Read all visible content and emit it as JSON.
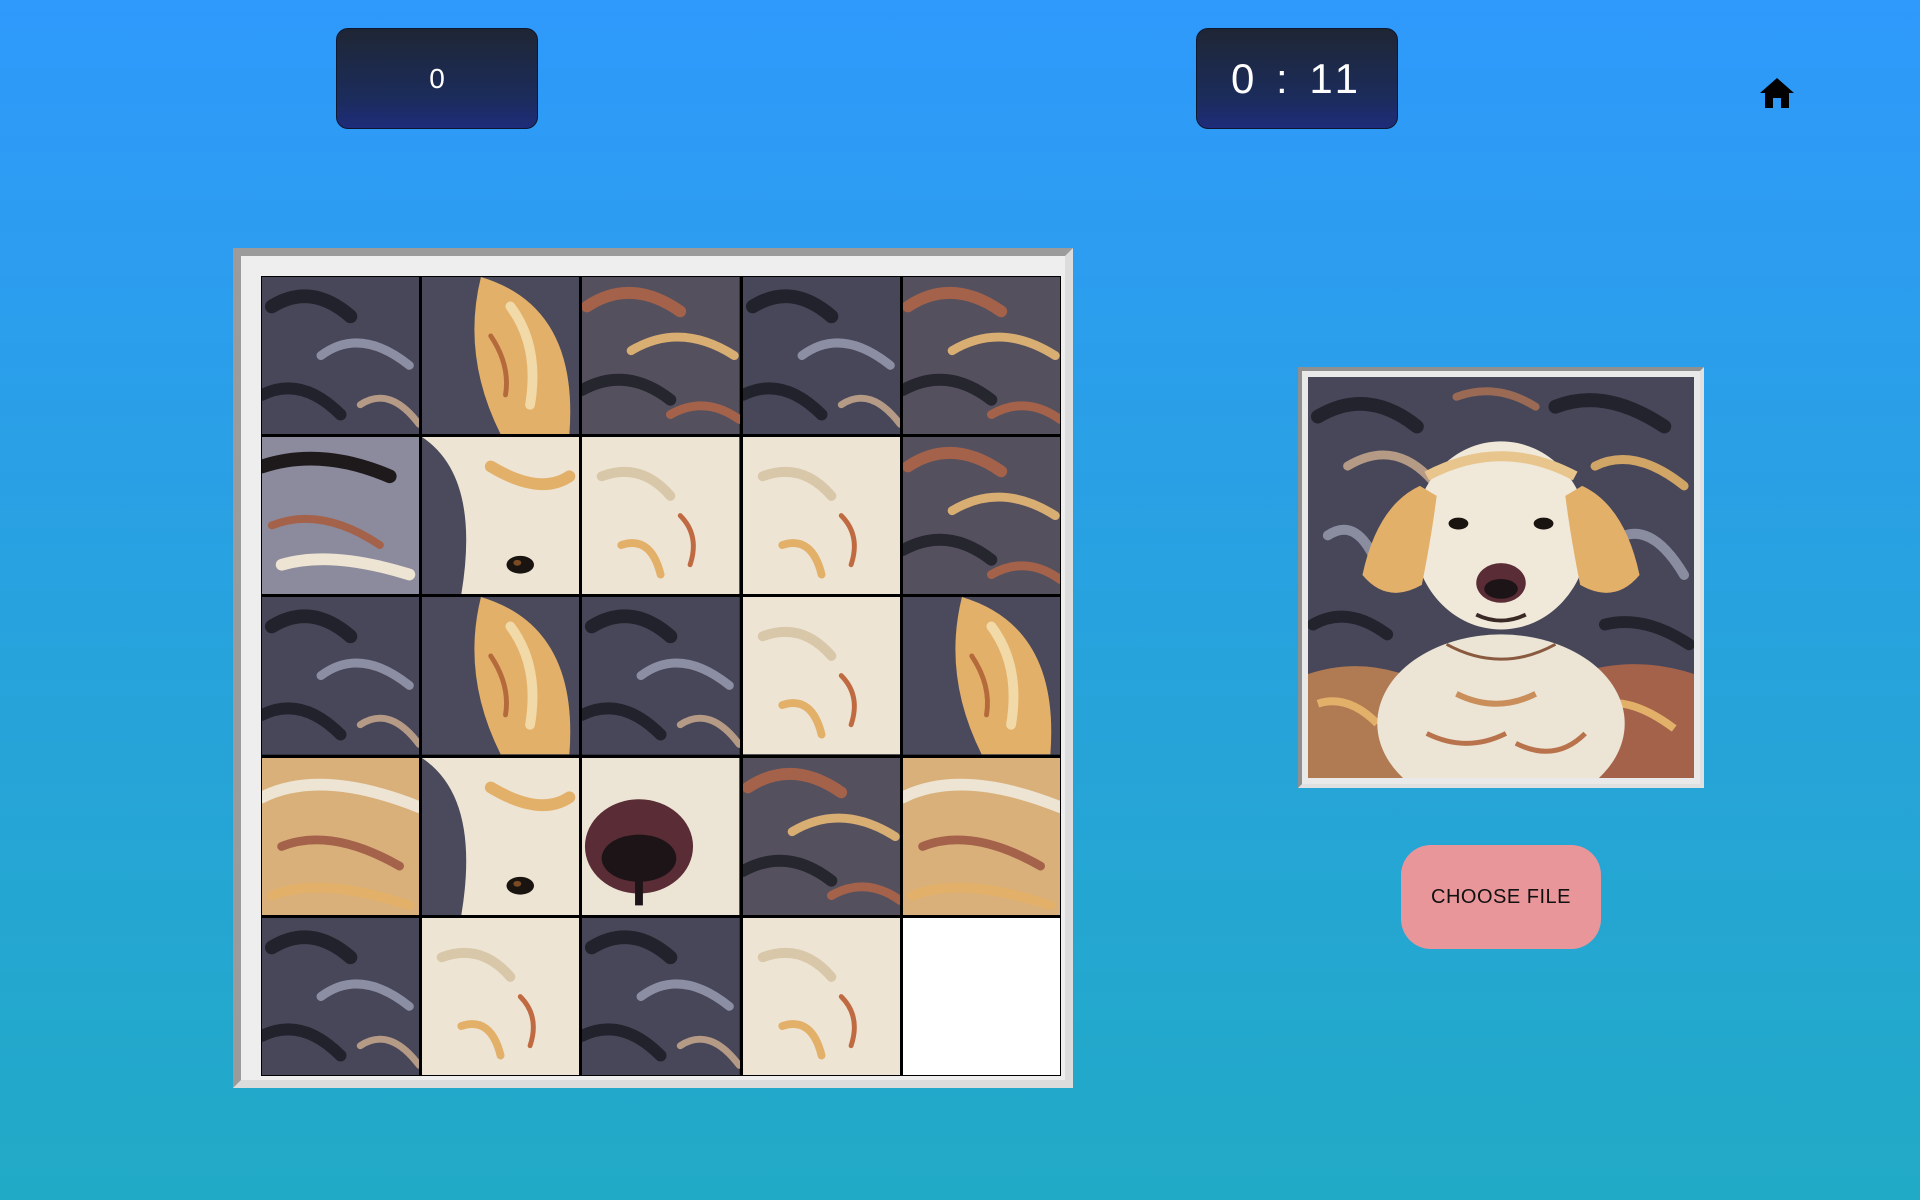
{
  "header": {
    "moves": "0",
    "timer": "0 : 11",
    "home_icon": "home-icon"
  },
  "puzzle": {
    "rows": 5,
    "cols": 5,
    "tiles": [
      {
        "row": 0,
        "col": 0,
        "kind": "dark"
      },
      {
        "row": 0,
        "col": 1,
        "kind": "ear"
      },
      {
        "row": 0,
        "col": 2,
        "kind": "rust"
      },
      {
        "row": 0,
        "col": 3,
        "kind": "dark"
      },
      {
        "row": 0,
        "col": 4,
        "kind": "rust"
      },
      {
        "row": 1,
        "col": 0,
        "kind": "mouth"
      },
      {
        "row": 1,
        "col": 1,
        "kind": "eye"
      },
      {
        "row": 1,
        "col": 2,
        "kind": "fur"
      },
      {
        "row": 1,
        "col": 3,
        "kind": "fur"
      },
      {
        "row": 1,
        "col": 4,
        "kind": "rust"
      },
      {
        "row": 2,
        "col": 0,
        "kind": "dark"
      },
      {
        "row": 2,
        "col": 1,
        "kind": "ear"
      },
      {
        "row": 2,
        "col": 2,
        "kind": "dark"
      },
      {
        "row": 2,
        "col": 3,
        "kind": "fur"
      },
      {
        "row": 2,
        "col": 4,
        "kind": "ear"
      },
      {
        "row": 3,
        "col": 0,
        "kind": "chest"
      },
      {
        "row": 3,
        "col": 1,
        "kind": "eye"
      },
      {
        "row": 3,
        "col": 2,
        "kind": "nose"
      },
      {
        "row": 3,
        "col": 3,
        "kind": "rust"
      },
      {
        "row": 3,
        "col": 4,
        "kind": "chest"
      },
      {
        "row": 4,
        "col": 0,
        "kind": "dark"
      },
      {
        "row": 4,
        "col": 1,
        "kind": "fur"
      },
      {
        "row": 4,
        "col": 2,
        "kind": "dark"
      },
      {
        "row": 4,
        "col": 3,
        "kind": "fur"
      },
      {
        "row": 4,
        "col": 4,
        "kind": "empty"
      }
    ]
  },
  "preview": {
    "image": "painted-dog-image"
  },
  "controls": {
    "choose_file_label": "CHOOSE FILE"
  },
  "colors": {
    "background_top": "#2f99fc",
    "background_bottom": "#21aac6",
    "counter_bg": "#1e2a5e",
    "button_pink": "#e8969a",
    "fur_cream": "#ede4d3",
    "fur_gold": "#e3b06a",
    "bg_slate": "#4a4a5c",
    "rust": "#a4624a",
    "nose": "#7a3a45"
  }
}
